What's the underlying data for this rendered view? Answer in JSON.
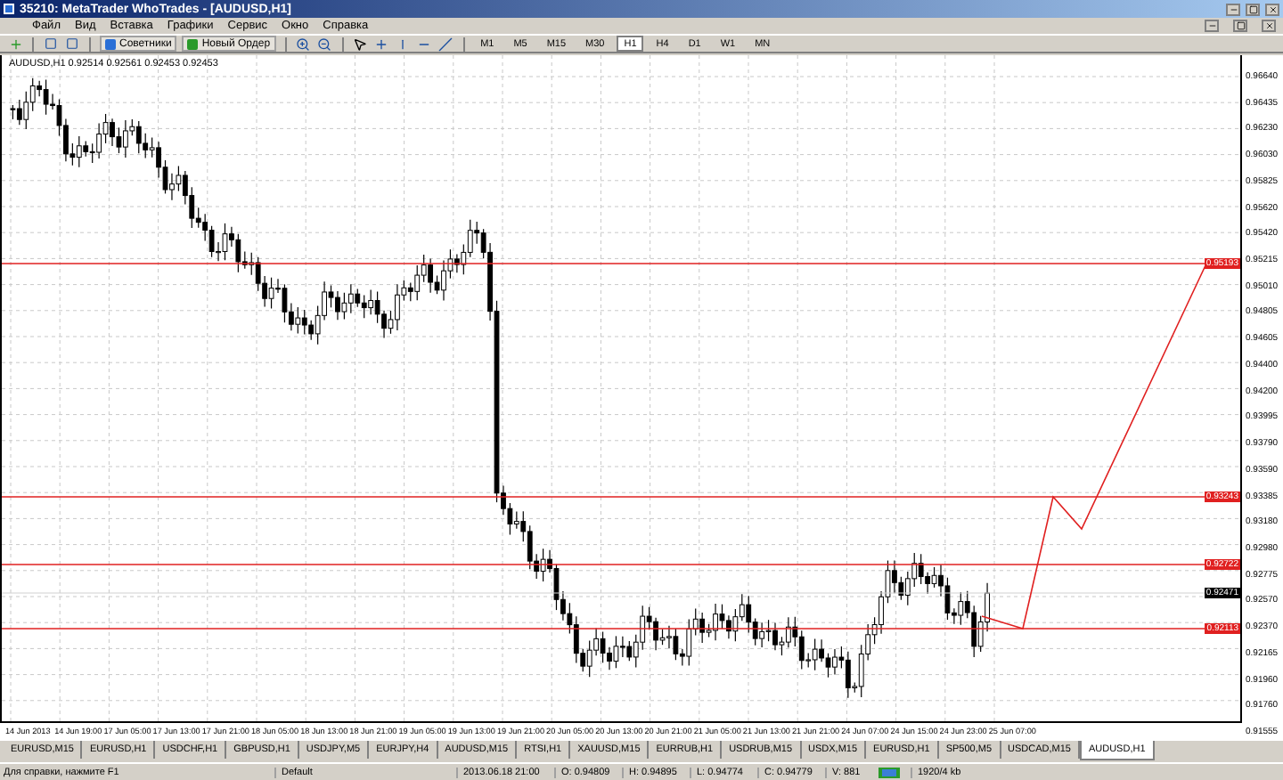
{
  "window": {
    "title": "35210: MetaTrader WhoTrades - [AUDUSD,H1]"
  },
  "menu": [
    "Файл",
    "Вид",
    "Вставка",
    "Графики",
    "Сервис",
    "Окно",
    "Справка"
  ],
  "toolbar": {
    "buttons": [
      {
        "label": "Советники",
        "kind": "experts"
      },
      {
        "label": "Новый Ордер",
        "kind": "order"
      }
    ],
    "timeframes": [
      {
        "label": "M1",
        "selected": false
      },
      {
        "label": "M5",
        "selected": false
      },
      {
        "label": "M15",
        "selected": false
      },
      {
        "label": "M30",
        "selected": false
      },
      {
        "label": "H1",
        "selected": true
      },
      {
        "label": "H4",
        "selected": false
      },
      {
        "label": "D1",
        "selected": false
      },
      {
        "label": "W1",
        "selected": false
      },
      {
        "label": "MN",
        "selected": false
      }
    ]
  },
  "chart": {
    "header": "AUDUSD,H1  0.92514 0.92561 0.92453 0.92453",
    "price_axis": [
      "0.96640",
      "0.96435",
      "0.96230",
      "0.96030",
      "0.95825",
      "0.95620",
      "0.95420",
      "0.95215",
      "0.95010",
      "0.94805",
      "0.94605",
      "0.94400",
      "0.94200",
      "0.93995",
      "0.93790",
      "0.93590",
      "0.93385",
      "0.93180",
      "0.92980",
      "0.92775",
      "0.92570",
      "0.92370",
      "0.92165",
      "0.91960",
      "0.91760",
      "0.91555"
    ],
    "time_axis": [
      "14 Jun 2013",
      "14 Jun 19:00",
      "17 Jun 05:00",
      "17 Jun 13:00",
      "17 Jun 21:00",
      "18 Jun 05:00",
      "18 Jun 13:00",
      "18 Jun 21:00",
      "19 Jun 05:00",
      "19 Jun 13:00",
      "19 Jun 21:00",
      "20 Jun 05:00",
      "20 Jun 13:00",
      "20 Jun 21:00",
      "21 Jun 05:00",
      "21 Jun 13:00",
      "21 Jun 21:00",
      "24 Jun 07:00",
      "24 Jun 15:00",
      "24 Jun 23:00",
      "25 Jun 07:00"
    ],
    "price_lines": [
      {
        "label": "0.95193",
        "kind": "level"
      },
      {
        "label": "0.93243",
        "kind": "level"
      },
      {
        "label": "0.92722",
        "kind": "level"
      },
      {
        "label": "0.92471",
        "kind": "bid"
      },
      {
        "label": "0.92113",
        "kind": "level"
      }
    ]
  },
  "tabs": [
    {
      "label": "EURUSD,M15",
      "selected": false
    },
    {
      "label": "EURUSD,H1",
      "selected": false
    },
    {
      "label": "USDCHF,H1",
      "selected": false
    },
    {
      "label": "GBPUSD,H1",
      "selected": false
    },
    {
      "label": "USDJPY,M5",
      "selected": false
    },
    {
      "label": "EURJPY,H4",
      "selected": false
    },
    {
      "label": "AUDUSD,M15",
      "selected": false
    },
    {
      "label": "RTSI,H1",
      "selected": false
    },
    {
      "label": "XAUUSD,M15",
      "selected": false
    },
    {
      "label": "EURRUB,H1",
      "selected": false
    },
    {
      "label": "USDRUB,M15",
      "selected": false
    },
    {
      "label": "USDX,M15",
      "selected": false
    },
    {
      "label": "EURUSD,H1",
      "selected": false
    },
    {
      "label": "SP500,M5",
      "selected": false
    },
    {
      "label": "USDCAD,M15",
      "selected": false
    },
    {
      "label": "AUDUSD,H1",
      "selected": true
    }
  ],
  "status_bar": {
    "help": "Для справки, нажмите F1",
    "profile": "Default",
    "time": "2013.06.18 21:00",
    "open": "O: 0.94809",
    "high": "H: 0.94895",
    "low": "L: 0.94774",
    "close": "C: 0.94779",
    "volume": "V: 881",
    "traffic": "1920/4 kb"
  }
}
